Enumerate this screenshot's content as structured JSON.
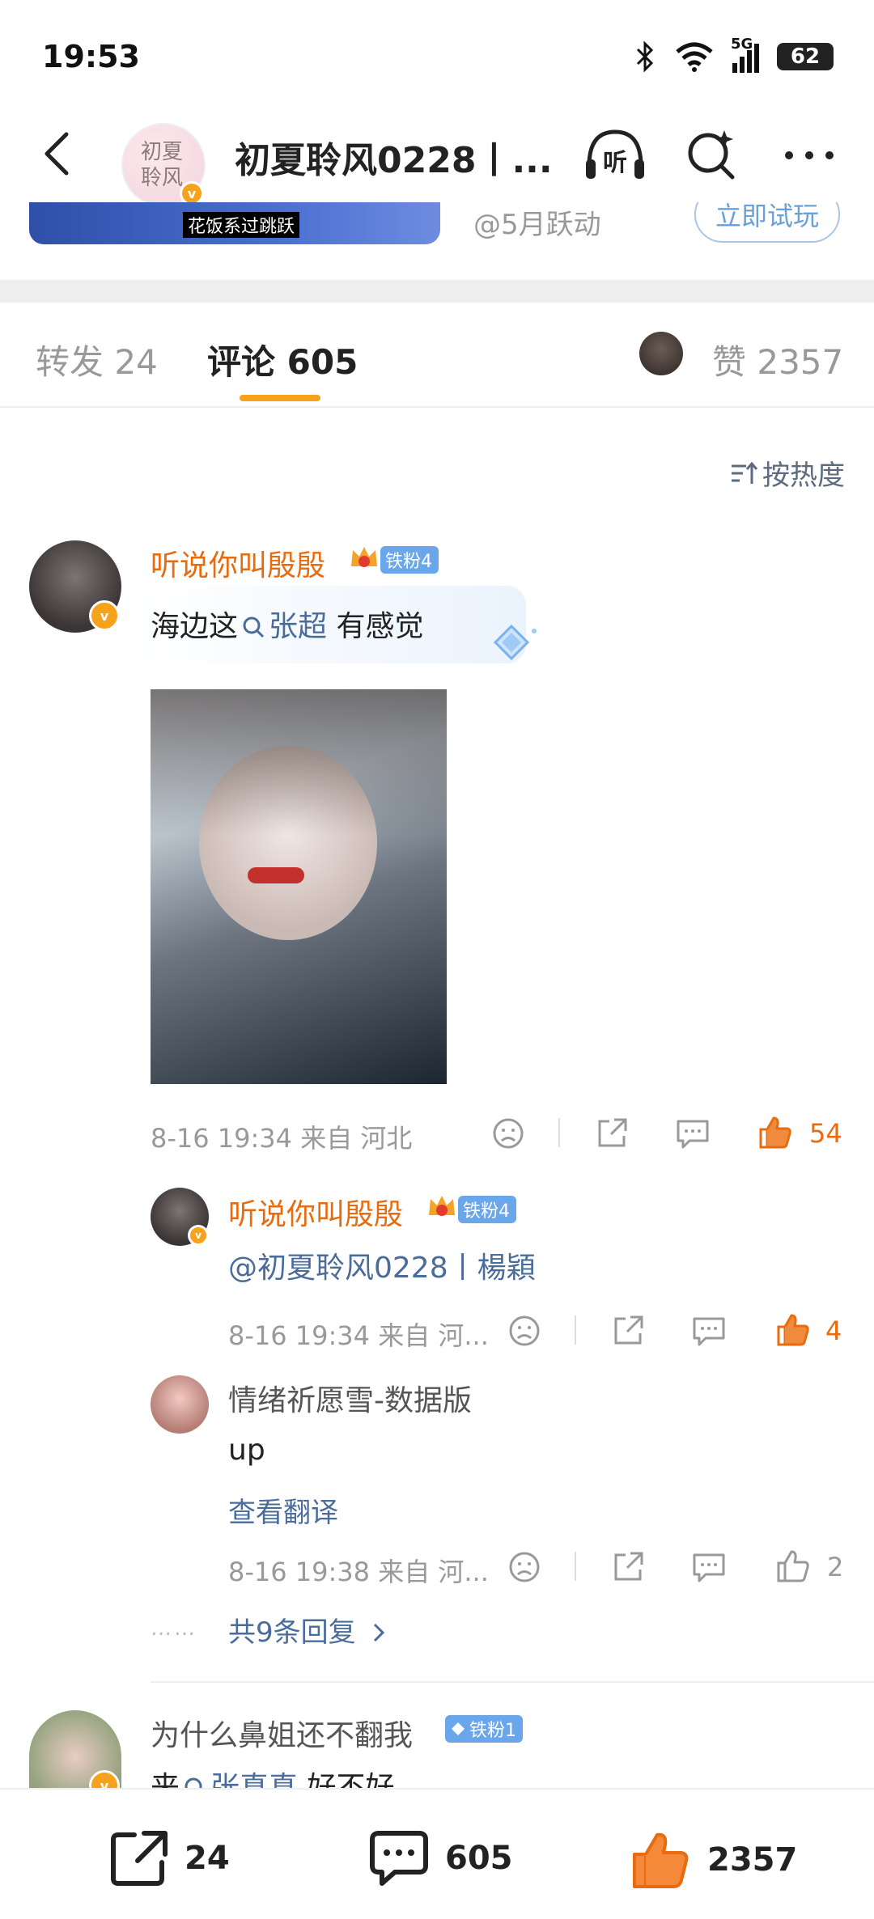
{
  "status": {
    "time": "19:53",
    "battery": "62",
    "network": "5G"
  },
  "nav": {
    "title": "初夏聆风0228丨...",
    "avatar_text_line1": "初夏",
    "avatar_text_line2": "聆风",
    "listen_label": "听"
  },
  "ad": {
    "text": "@5月跃动",
    "button": "立即试玩",
    "image_caption": "花饭系过跳跃"
  },
  "tabs": {
    "repost": "转发 24",
    "comments": "评论 605",
    "likes": "赞 2357"
  },
  "sort": {
    "label": "按热度"
  },
  "comments": [
    {
      "username": "听说你叫殷殷",
      "badge": "铁粉4",
      "text_before": "海边这",
      "mention": "张超",
      "text_after": " 有感觉",
      "time": "8-16 19:34",
      "location": "来自 河北",
      "likes": "54",
      "replies": [
        {
          "username": "听说你叫殷殷",
          "badge": "铁粉4",
          "text": "@初夏聆风0228丨楊穎",
          "time": "8-16 19:34",
          "location": "来自 河...",
          "likes": "4"
        },
        {
          "username": "情绪祈愿雪-数据版",
          "text": "up",
          "translate": "查看翻译",
          "time": "8-16 19:38",
          "location": "来自 河...",
          "likes": "2"
        }
      ],
      "more_replies": "共9条回复",
      "more_dots": "……"
    },
    {
      "username": "为什么鼻姐还不翻我",
      "badge": "铁粉1",
      "text_before": "来",
      "mention": "张真真",
      "text_after": " 好不好"
    }
  ],
  "bottom_bar": {
    "repost": "24",
    "comments": "605",
    "likes": "2357"
  },
  "colors": {
    "accent_orange": "#e86b0f",
    "tab_indicator": "#f7a21b",
    "link_blue": "#4a6c9b",
    "badge_blue": "#6aa6ea"
  }
}
